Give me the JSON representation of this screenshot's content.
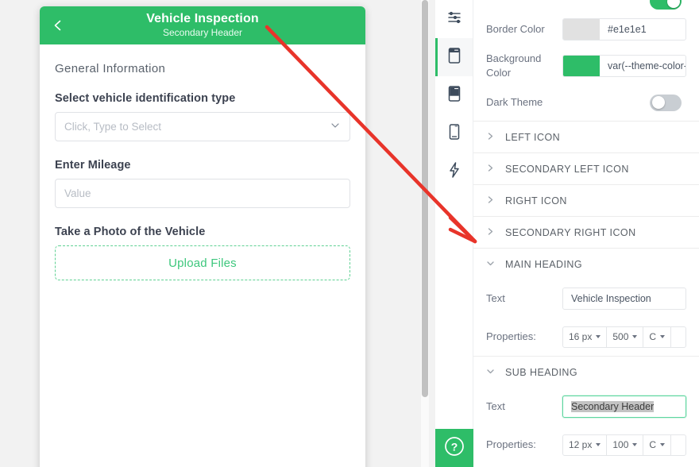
{
  "preview": {
    "header": {
      "back_icon": "chevron-left-icon",
      "main_heading": "Vehicle Inspection",
      "sub_heading": "Secondary Header"
    },
    "section_title": "General Information",
    "fields": [
      {
        "label": "Select vehicle identification type",
        "placeholder": "Click, Type to Select",
        "type": "select",
        "icon": "chevron-down-icon"
      },
      {
        "label": "Enter Mileage",
        "placeholder": "Value",
        "type": "text"
      }
    ],
    "upload": {
      "label": "Take a Photo of the Vehicle",
      "button_label": "Upload Files"
    }
  },
  "rail": {
    "items": [
      {
        "icon": "sliders-icon",
        "active": false
      },
      {
        "icon": "header-layout-icon",
        "active": true
      },
      {
        "icon": "footer-layout-icon",
        "active": false
      },
      {
        "icon": "mobile-device-icon",
        "active": false
      },
      {
        "icon": "lightning-bolt-icon",
        "active": false
      }
    ],
    "help": {
      "icon": "question-mark-icon"
    }
  },
  "properties": {
    "top_toggle": {
      "state": "on"
    },
    "border_color": {
      "label": "Border Color",
      "value": "#e1e1e1",
      "swatch": "#e1e1e1"
    },
    "background_color": {
      "label": "Background Color",
      "value": "var(--theme-color-ba",
      "swatch": "#2ebd68"
    },
    "dark_theme": {
      "label": "Dark Theme",
      "state": "off"
    },
    "sections": [
      {
        "title": "LEFT ICON",
        "expanded": false,
        "icon": "chevron-right-icon"
      },
      {
        "title": "SECONDARY LEFT ICON",
        "expanded": false,
        "icon": "chevron-right-icon"
      },
      {
        "title": "RIGHT ICON",
        "expanded": false,
        "icon": "chevron-right-icon"
      },
      {
        "title": "SECONDARY RIGHT ICON",
        "expanded": false,
        "icon": "chevron-right-icon"
      }
    ],
    "main_heading": {
      "title": "MAIN HEADING",
      "expanded": true,
      "icon": "chevron-down-icon",
      "text_label": "Text",
      "text_value": "Vehicle Inspection",
      "props_label": "Properties:",
      "font_size": "16 px",
      "font_weight": "500",
      "align": "C"
    },
    "sub_heading": {
      "title": "SUB HEADING",
      "expanded": true,
      "icon": "chevron-down-icon",
      "text_label": "Text",
      "text_value": "Secondary Header",
      "text_selected": true,
      "props_label": "Properties:",
      "font_size": "12 px",
      "font_weight": "100",
      "align": "C"
    }
  },
  "annotation": {
    "arrow_color": "#e8342a"
  }
}
